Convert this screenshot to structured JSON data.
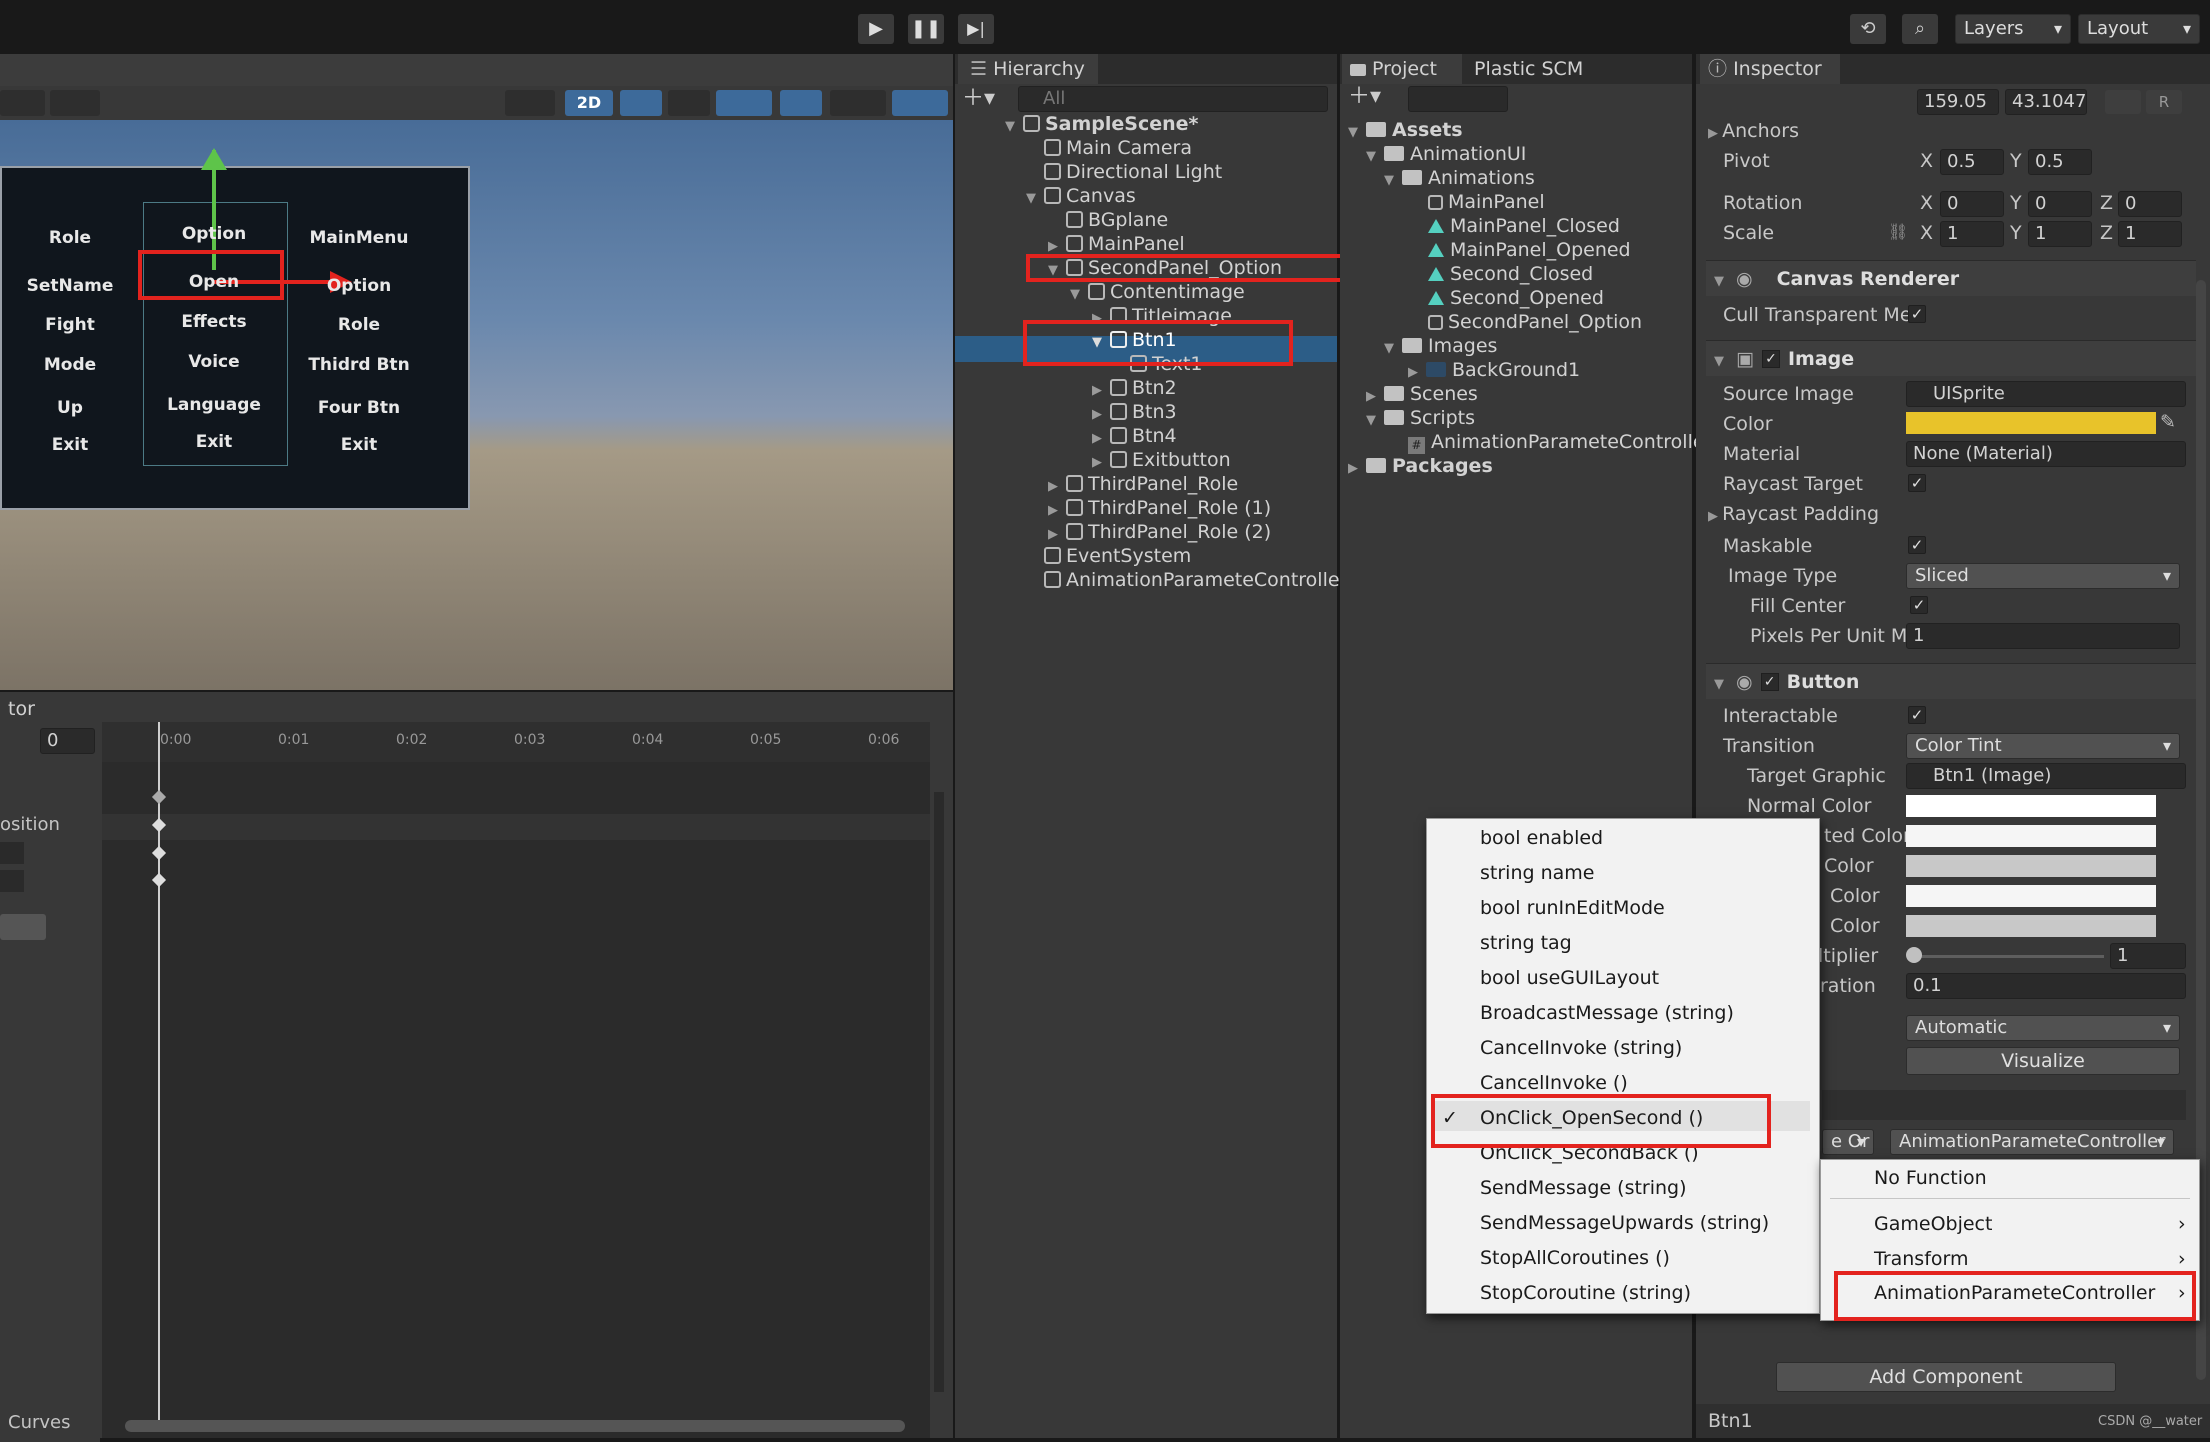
{
  "toolbar": {
    "layers_label": "Layers",
    "layout_label": "Layout",
    "btn_2d": "2D"
  },
  "tabs": {
    "hierarchy": "Hierarchy",
    "project": "Project",
    "plastic": "Plastic SCM",
    "inspector": "Inspector",
    "animator": "tor",
    "curves": "Curves"
  },
  "hierarchy": {
    "search_placeholder": "All",
    "items": [
      {
        "label": "SampleScene*"
      },
      {
        "label": "Main Camera"
      },
      {
        "label": "Directional Light"
      },
      {
        "label": "Canvas"
      },
      {
        "label": "BGplane"
      },
      {
        "label": "MainPanel"
      },
      {
        "label": "SecondPanel_Option"
      },
      {
        "label": "Contentimage"
      },
      {
        "label": "Titleimage"
      },
      {
        "label": "Btn1"
      },
      {
        "label": "Text1"
      },
      {
        "label": "Btn2"
      },
      {
        "label": "Btn3"
      },
      {
        "label": "Btn4"
      },
      {
        "label": "Exitbutton"
      },
      {
        "label": "ThirdPanel_Role"
      },
      {
        "label": "ThirdPanel_Role (1)"
      },
      {
        "label": "ThirdPanel_Role (2)"
      },
      {
        "label": "EventSystem"
      },
      {
        "label": "AnimationParameteController"
      }
    ]
  },
  "project": {
    "items": [
      {
        "label": "Assets"
      },
      {
        "label": "AnimationUI"
      },
      {
        "label": "Animations"
      },
      {
        "label": "MainPanel"
      },
      {
        "label": "MainPanel_Closed"
      },
      {
        "label": "MainPanel_Opened"
      },
      {
        "label": "Second_Closed"
      },
      {
        "label": "Second_Opened"
      },
      {
        "label": "SecondPanel_Option"
      },
      {
        "label": "Images"
      },
      {
        "label": "BackGround1"
      },
      {
        "label": "Scenes"
      },
      {
        "label": "Scripts"
      },
      {
        "label": "AnimationParameteController"
      },
      {
        "label": "Packages"
      }
    ]
  },
  "scene": {
    "left": [
      "Role",
      "SetName",
      "Fight",
      "Mode",
      "Up",
      "Exit"
    ],
    "mid": [
      "Option",
      "Open",
      "Effects",
      "Voice",
      "Language",
      "Exit"
    ],
    "right": [
      "MainMenu",
      "Option",
      "Role",
      "Thidrd Btn",
      "Four Btn",
      "Exit"
    ]
  },
  "animator": {
    "frame": "0",
    "times": [
      "0:00",
      "0:01",
      "0:02",
      "0:03",
      "0:04",
      "0:05",
      "0:06"
    ],
    "prop": "osition"
  },
  "inspector": {
    "size_w": "159.05",
    "size_h": "43.1047",
    "anchors": "Anchors",
    "pivot": "Pivot",
    "pivot_x": "0.5",
    "pivot_y": "0.5",
    "rotation": "Rotation",
    "rot": [
      "0",
      "0",
      "0"
    ],
    "scale": "Scale",
    "scl": [
      "1",
      "1",
      "1"
    ],
    "canvas_renderer": "Canvas Renderer",
    "cull": "Cull Transparent Me",
    "image": "Image",
    "source_image": "Source Image",
    "source_val": "UISprite",
    "color": "Color",
    "material": "Material",
    "material_val": "None (Material)",
    "raycast_target": "Raycast Target",
    "raycast_padding": "Raycast Padding",
    "maskable": "Maskable",
    "image_type": "Image Type",
    "image_type_val": "Sliced",
    "fill_center": "Fill Center",
    "ppu": "Pixels Per Unit Mu",
    "ppu_val": "1",
    "button": "Button",
    "interactable": "Interactable",
    "transition": "Transition",
    "transition_val": "Color Tint",
    "target_graphic": "Target Graphic",
    "target_val": "Btn1 (Image)",
    "normal_color": "Normal Color",
    "highlighted": "ted Color",
    "pressed": "Color",
    "selected": "Color",
    "disabled": "Color",
    "multiplier": "ltiplier",
    "multiplier_val": "1",
    "fade": "ration",
    "fade_val": "0.1",
    "navigation_val": "Automatic",
    "visualize": "Visualize",
    "runtime": "e Or",
    "onclick_target": "AnimationParameteController",
    "add_component": "Add Component",
    "footer": "Btn1",
    "watermark": "CSDN @__water"
  },
  "menu_left": [
    "bool enabled",
    "string name",
    "bool runInEditMode",
    "string tag",
    "bool useGUILayout",
    "BroadcastMessage (string)",
    "CancelInvoke (string)",
    "CancelInvoke ()",
    "OnClick_OpenSecond ()",
    "OnClick_SecondBack ()",
    "SendMessage (string)",
    "SendMessageUpwards (string)",
    "StopAllCoroutines ()",
    "StopCoroutine (string)"
  ],
  "menu_right": [
    "No Function",
    "GameObject",
    "Transform",
    "AnimationParameteController"
  ],
  "colors": {
    "panel": "#383838",
    "selection": "#2c5d87",
    "highlight_red": "#e3231e",
    "image_color": "#e8c32a"
  }
}
